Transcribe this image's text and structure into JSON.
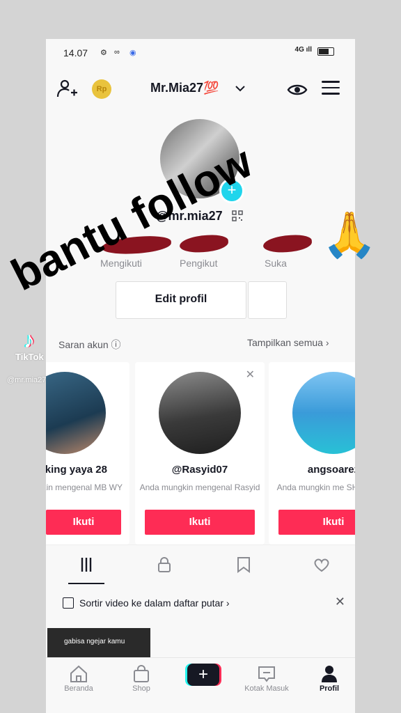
{
  "status_bar": {
    "time": "14.07",
    "signal": "4G",
    "signal_label": "ıll"
  },
  "header": {
    "username": "Mr.Mia27",
    "username_emoji": "💯",
    "coin_label": "Rp"
  },
  "profile": {
    "handle": "@mr.mia27",
    "stats": [
      {
        "label": "Mengikuti"
      },
      {
        "label": "Pengikut"
      },
      {
        "label": "Suka"
      }
    ],
    "edit_label": "Edit profil"
  },
  "suggestions": {
    "title": "Saran akun ⓘ",
    "show_all": "Tampilkan semua ›",
    "cards": [
      {
        "name": "king yaya 28",
        "sub": "ungkin mengenal MB WY",
        "button": "Ikuti"
      },
      {
        "name": "@Rasyid07",
        "sub": "Anda mungkin mengenal Rasyid",
        "button": "Ikuti"
      },
      {
        "name": "angsoarez",
        "sub": "Anda mungkin me SHatria Ajja",
        "button": "Ikuti"
      }
    ]
  },
  "tabs": [
    {
      "icon": "grid-icon"
    },
    {
      "icon": "lock-icon"
    },
    {
      "icon": "bookmark-icon"
    },
    {
      "icon": "heart-icon"
    }
  ],
  "playlist": {
    "text": "Sortir video ke dalam daftar putar ›"
  },
  "thumbnail": {
    "caption": "gabisa ngejar kamu"
  },
  "bottom_nav": [
    {
      "label": "Beranda",
      "icon": "home-icon"
    },
    {
      "label": "Shop",
      "icon": "shop-icon"
    },
    {
      "label": "",
      "icon": "create-icon"
    },
    {
      "label": "Kotak Masuk",
      "icon": "inbox-icon"
    },
    {
      "label": "Profil",
      "icon": "profile-icon"
    }
  ],
  "overlay": {
    "text": "bantu follow",
    "emoji": "🙏"
  },
  "watermark": {
    "logo_text": "TikTok",
    "user": "@mr.mia27"
  },
  "colors": {
    "accent": "#fe2c55",
    "cyan": "#20d5ec",
    "redact": "#8a1420"
  }
}
